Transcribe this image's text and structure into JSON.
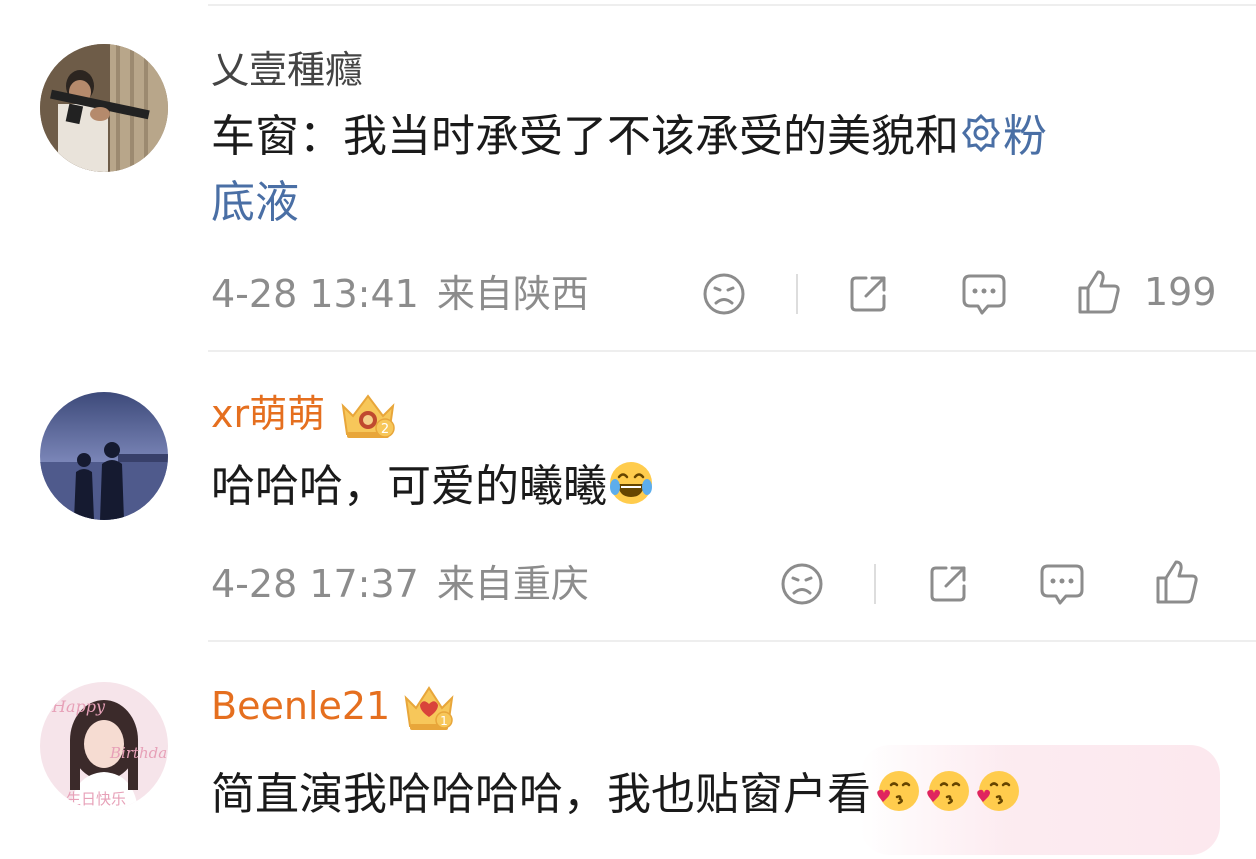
{
  "comments": [
    {
      "username": "乂壹種癮",
      "text_prefix": "车窗：我当时承受了不该承受的美貌和",
      "link_text": "粉",
      "text_line2": "底液",
      "timestamp": "4-28 13:41",
      "location": "来自陕西",
      "like_count": "199"
    },
    {
      "username": "xr萌萌",
      "badge_level": "2",
      "text": "哈哈哈，可爱的曦曦",
      "timestamp": "4-28 17:37",
      "location": "来自重庆"
    },
    {
      "username": "Beenle21",
      "badge_level": "1",
      "avatar_text_1": "Happy",
      "avatar_text_2": "Birthday",
      "avatar_text_3": "生日快乐",
      "text": "简直演我哈哈哈哈，我也贴窗户看"
    }
  ],
  "colors": {
    "orange_username": "#e56f1f",
    "link_blue": "#4a6fa5",
    "meta_gray": "#8c8c8c"
  },
  "icons": [
    "dislike-icon",
    "share-icon",
    "comment-icon",
    "like-icon",
    "crown-badge-icon",
    "laugh-cry-emoji",
    "kiss-emoji",
    "flower-link-icon"
  ]
}
